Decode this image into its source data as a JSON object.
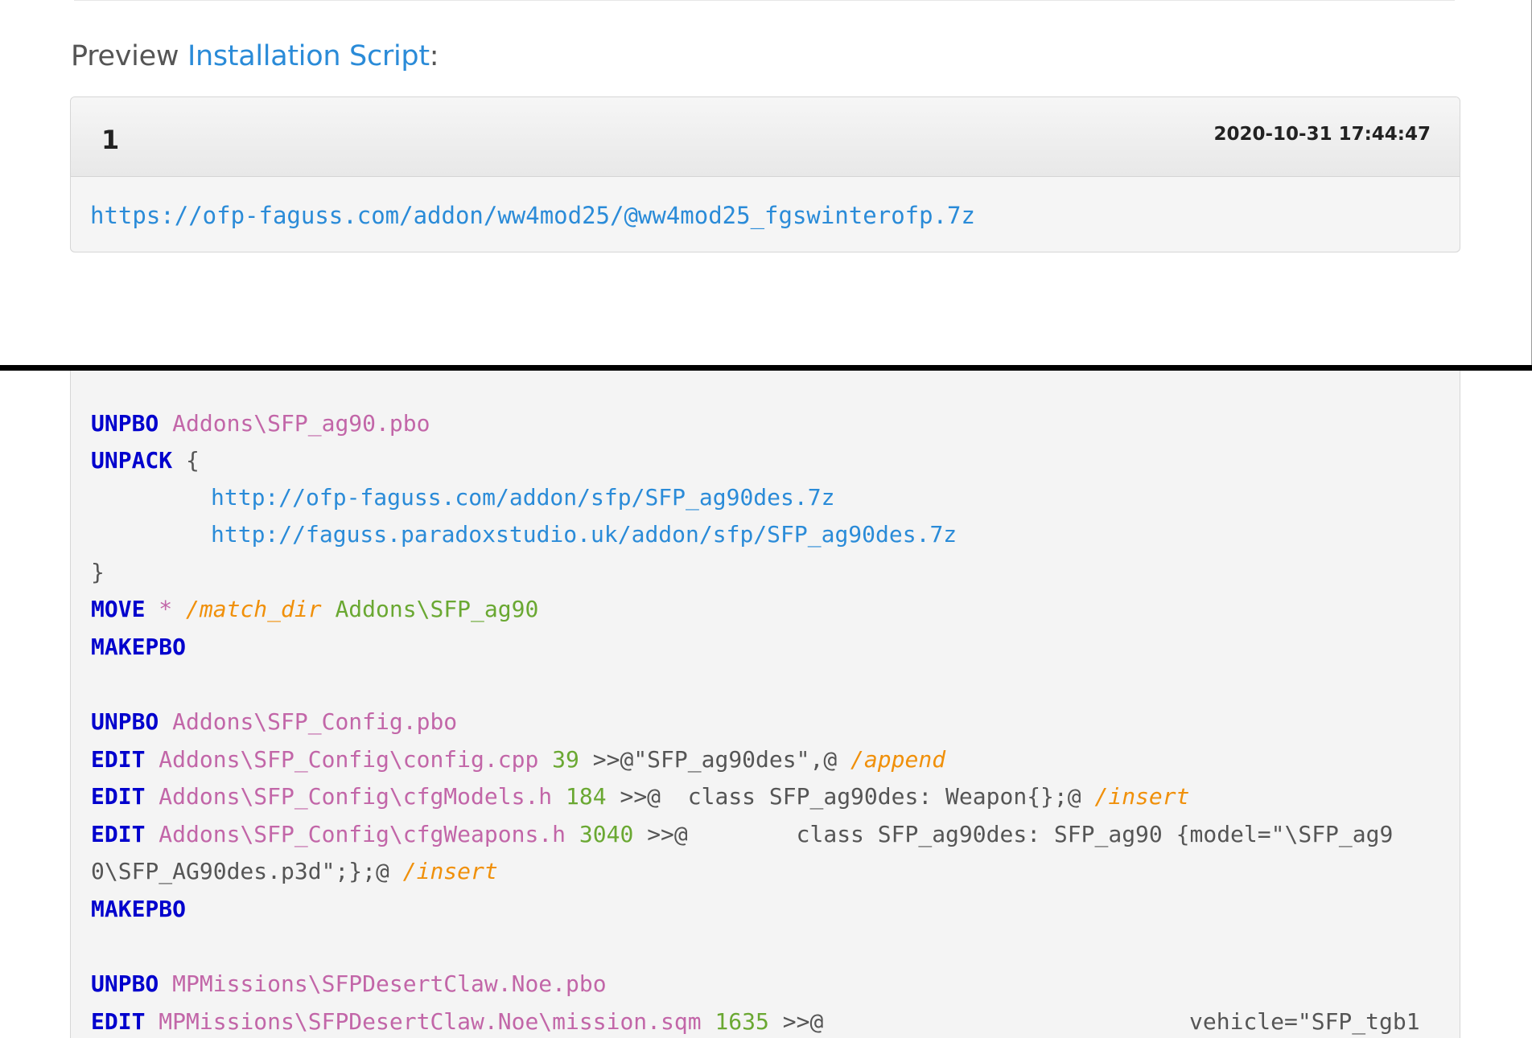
{
  "heading": {
    "prefix": "Preview",
    "link": "Installation Script",
    "suffix": ":"
  },
  "panel": {
    "number": "1",
    "date": "2020-10-31 17:44:47",
    "url": "https://ofp-faguss.com/addon/ww4mod25/@ww4mod25_fgswinterofp.7z"
  },
  "code": {
    "l1": {
      "kw": "UNPBO",
      "path": "Addons\\SFP_ag90.pbo"
    },
    "l2": {
      "kw": "UNPACK",
      "brace": "{"
    },
    "l3": {
      "url": "http://ofp-faguss.com/addon/sfp/SFP_ag90des.7z"
    },
    "l4": {
      "url": "http://faguss.paradoxstudio.uk/addon/sfp/SFP_ag90des.7z"
    },
    "l5": {
      "brace": "}"
    },
    "l6": {
      "kw": "MOVE",
      "star": "*",
      "opt": "/match_dir",
      "target": "Addons\\SFP_ag90"
    },
    "l7": {
      "kw": "MAKEPBO"
    },
    "l8": {
      "kw": "UNPBO",
      "path": "Addons\\SFP_Config.pbo"
    },
    "l9": {
      "kw": "EDIT",
      "path": "Addons\\SFP_Config\\config.cpp",
      "num": "39",
      "text": ">>@\"SFP_ag90des\",@",
      "opt": "/append"
    },
    "l10": {
      "kw": "EDIT",
      "path": "Addons\\SFP_Config\\cfgModels.h",
      "num": "184",
      "text": ">>@  class SFP_ag90des: Weapon{};@",
      "opt": "/insert"
    },
    "l11": {
      "kw": "EDIT",
      "path": "Addons\\SFP_Config\\cfgWeapons.h",
      "num": "3040",
      "text": ">>@        class SFP_ag90des: SFP_ag90 {model=\"\\SFP_ag9"
    },
    "l12": {
      "text": "0\\SFP_AG90des.p3d\";};@",
      "opt": "/insert"
    },
    "l13": {
      "kw": "MAKEPBO"
    },
    "l14": {
      "kw": "UNPBO",
      "path": "MPMissions\\SFPDesertClaw.Noe.pbo"
    },
    "l15": {
      "kw": "EDIT",
      "path": "MPMissions\\SFPDesertClaw.Noe\\mission.sqm",
      "num": "1635",
      "text": ">>@",
      "text2": "vehicle=\"SFP_tgb1"
    }
  },
  "colors": {
    "keyword": "#0000cd",
    "path": "#c266a8",
    "url": "#2a8bd8",
    "number": "#6aa832",
    "option": "#f0900a",
    "text": "#555555"
  }
}
